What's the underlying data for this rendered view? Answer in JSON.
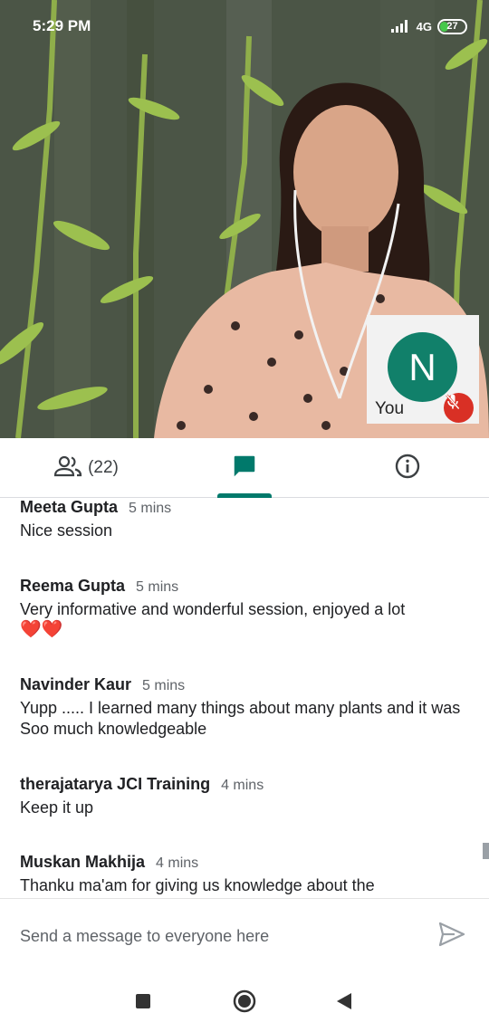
{
  "status_bar": {
    "time": "5:29 PM",
    "network": "4G",
    "battery": "27"
  },
  "self_tile": {
    "initial": "N",
    "label": "You",
    "avatar_color": "#11806a",
    "muted": true
  },
  "tabs": {
    "people_count": "(22)",
    "active_tab": "chat",
    "accent_color": "#00796b"
  },
  "chat": {
    "messages": [
      {
        "sender": "Meeta Gupta",
        "time": "5 mins",
        "text": "Nice session"
      },
      {
        "sender": "Reema Gupta",
        "time": "5 mins",
        "text": "Very informative and  wonderful session, enjoyed a lot",
        "emoji": "❤️❤️"
      },
      {
        "sender": "Navinder Kaur",
        "time": "5 mins",
        "text": "Yupp ..... I learned many things about many plants and it was Soo much knowledgeable"
      },
      {
        "sender": "therajatarya JCI Training",
        "time": "4 mins",
        "text": "Keep it up"
      },
      {
        "sender": "Muskan Makhija",
        "time": "4 mins",
        "text": "Thanku ma'am for giving us knowledge about the"
      }
    ]
  },
  "composer": {
    "placeholder": "Send a message to everyone here"
  },
  "icons": {
    "people": "people-icon",
    "chat": "chat-icon",
    "info": "info-icon",
    "send": "send-icon",
    "mute": "mic-off-icon"
  }
}
